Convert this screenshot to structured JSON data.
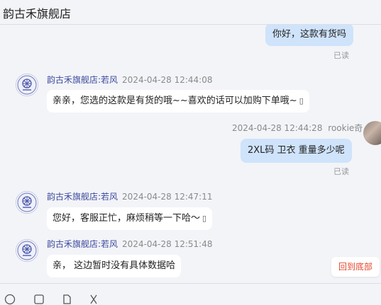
{
  "header": {
    "title": "韵古禾旗舰店"
  },
  "messages": [
    {
      "dir": "out",
      "text": "你好，这款有货吗",
      "status": "已读"
    },
    {
      "dir": "in",
      "sender": "韵古禾旗舰店:若风",
      "time": "2024-04-28 12:44:08",
      "text": "亲亲，您选的这款是有货的哦~~喜欢的话可以加购下单哦~",
      "trailing_icon": "emoji-icon"
    },
    {
      "dir": "out",
      "sender": "rookie奇",
      "time": "2024-04-28 12:44:28",
      "text": "2XL码 卫衣  重量多少呢",
      "status": "已读"
    },
    {
      "dir": "in",
      "sender": "韵古禾旗舰店:若风",
      "time": "2024-04-28 12:47:11",
      "text": "您好，客服正忙，麻烦稍等一下哈～",
      "trailing_icon": "emoji-icon"
    },
    {
      "dir": "in",
      "sender": "韵古禾旗舰店:若风",
      "time": "2024-04-28 12:51:48",
      "text": "亲， 这边暂时没有具体数据哈"
    }
  ],
  "scroll_button": {
    "label": "回到底部"
  },
  "toolbar": {
    "icons": [
      "emoji-icon",
      "image-icon",
      "file-icon",
      "scissors-icon"
    ]
  },
  "colors": {
    "out_bubble": "#cfe3fb",
    "in_bubble": "#ffffff",
    "sender": "#3d4a9c",
    "scroll_label": "#e5462d"
  }
}
